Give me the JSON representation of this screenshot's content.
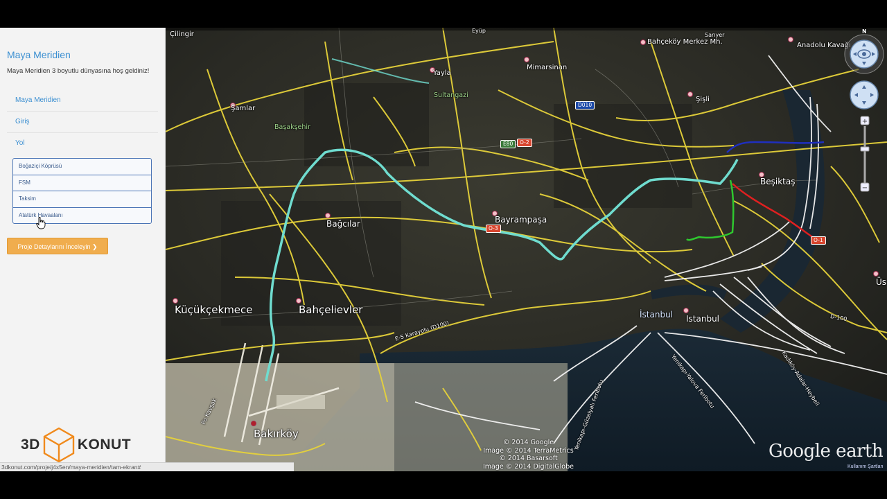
{
  "sidebar": {
    "brand": "Maya Meridien",
    "welcome": "Maya Meridien 3 boyutlu dünyasına hoş geldiniz!",
    "menu": [
      {
        "label": "Maya Meridien"
      },
      {
        "label": "Giriş"
      },
      {
        "label": "Yol"
      }
    ],
    "routes": [
      {
        "label": "Boğaziçi Köprüsü"
      },
      {
        "label": "FSM"
      },
      {
        "label": "Taksim"
      },
      {
        "label": "Atatürk Havaalanı"
      }
    ],
    "cta_label": "Proje Detaylarını İnceleyin ❯",
    "logo_left": "3D",
    "logo_right": "KONUT",
    "status_url": "3dkonut.com/proje/j4x5en/maya-meridien/tam-ekran#"
  },
  "map": {
    "places": [
      {
        "name": "Çilingir"
      },
      {
        "name": "Eyüp"
      },
      {
        "name": "Sarıyer"
      },
      {
        "name": "Bahçeköy Merkez Mh."
      },
      {
        "name": "Anadolu Kavağı"
      },
      {
        "name": "Yayla"
      },
      {
        "name": "Mimarsinan"
      },
      {
        "name": "Sultangazi"
      },
      {
        "name": "Şamlar"
      },
      {
        "name": "Başakşehir"
      },
      {
        "name": "Şişli"
      },
      {
        "name": "Beşiktaş"
      },
      {
        "name": "Bağcılar"
      },
      {
        "name": "Bayrampaşa"
      },
      {
        "name": "Küçükçekmece"
      },
      {
        "name": "Bahçelievler"
      },
      {
        "name": "İstanbul"
      },
      {
        "name": "Istanbul"
      },
      {
        "name": "Bakırköy"
      },
      {
        "name": "Üs"
      }
    ],
    "road_shields": [
      {
        "label": "E80",
        "color": "green"
      },
      {
        "label": "O-2",
        "color": "red"
      },
      {
        "label": "D010",
        "color": "blue"
      },
      {
        "label": "O-3",
        "color": "red"
      },
      {
        "label": "O-1",
        "color": "red"
      }
    ],
    "road_labels": [
      {
        "name": "E-5 Karayolu (D100)"
      },
      {
        "name": "Yenikapı-Güzelyalı Feribotu"
      },
      {
        "name": "Yenikapı-Yalova Feribotu"
      },
      {
        "name": "Kadıköy-Adalar-Heybeli"
      },
      {
        "name": "D-100"
      },
      {
        "name": "Po Kavşak"
      }
    ],
    "credits": [
      "© 2014 Google",
      "Image © 2014 TerraMetrics",
      "© 2014 Basarsoft",
      "Image © 2014 DigitalGlobe"
    ],
    "logo": "Google earth",
    "terms": "Kullanım Şartları",
    "north_label": "N",
    "route_colors": {
      "route": "#6fdccf",
      "blue": "#1f2fbf",
      "red": "#e02020",
      "green": "#2fc82f",
      "roads": "#e6d23a"
    }
  }
}
